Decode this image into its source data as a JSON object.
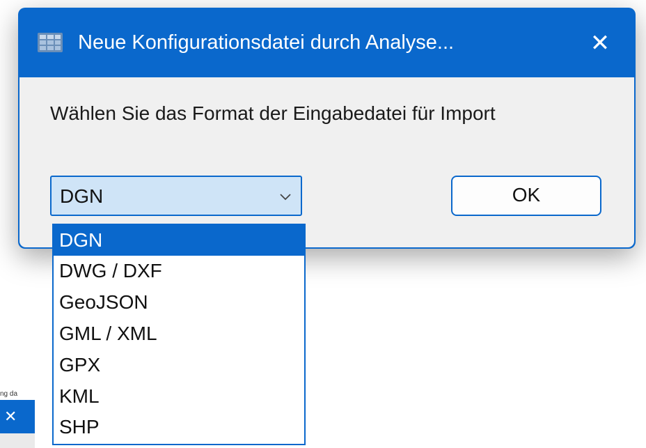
{
  "background_window": {
    "title_fragment": "ng da",
    "close_glyph": "✕"
  },
  "dialog": {
    "app_icon": "table-grid-icon",
    "title": "Neue Konfigurationsdatei durch Analyse...",
    "close_glyph": "✕",
    "prompt": "Wählen Sie das Format der Eingabedatei für Import",
    "format_select": {
      "selected": "DGN",
      "options": [
        "DGN",
        "DWG / DXF",
        "GeoJSON",
        "GML / XML",
        "GPX",
        "KML",
        "SHP"
      ]
    },
    "ok_label": "OK"
  },
  "colors": {
    "accent": "#0a68cc",
    "dialog_body": "#f0f0f0",
    "combo_fill": "#cfe4f7"
  }
}
